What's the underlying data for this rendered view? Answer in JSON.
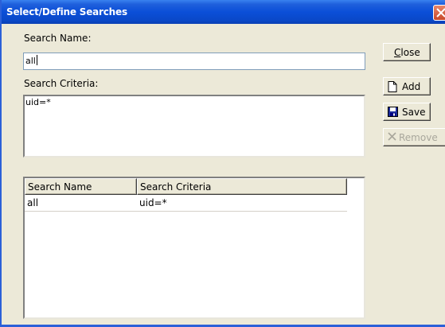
{
  "window": {
    "title": "Select/Define Searches"
  },
  "form": {
    "search_name_label": "Search Name:",
    "search_name_value": "all",
    "search_criteria_label": "Search Criteria:",
    "search_criteria_value": "uid=*"
  },
  "buttons": {
    "close": "Close",
    "add": "Add",
    "save": "Save",
    "remove": "Remove"
  },
  "table": {
    "columns": [
      "Search Name",
      "Search Criteria"
    ],
    "rows": [
      [
        "all",
        "uid=*"
      ]
    ]
  },
  "colors": {
    "title_bar": "#0b4fd8",
    "dialog_face": "#ece9d8",
    "close_button": "#c8482a",
    "disabled_text": "#a9a79c"
  },
  "icons": {
    "close": "close-icon",
    "add": "new-document-icon",
    "save": "floppy-disk-icon",
    "remove": "x-icon"
  }
}
